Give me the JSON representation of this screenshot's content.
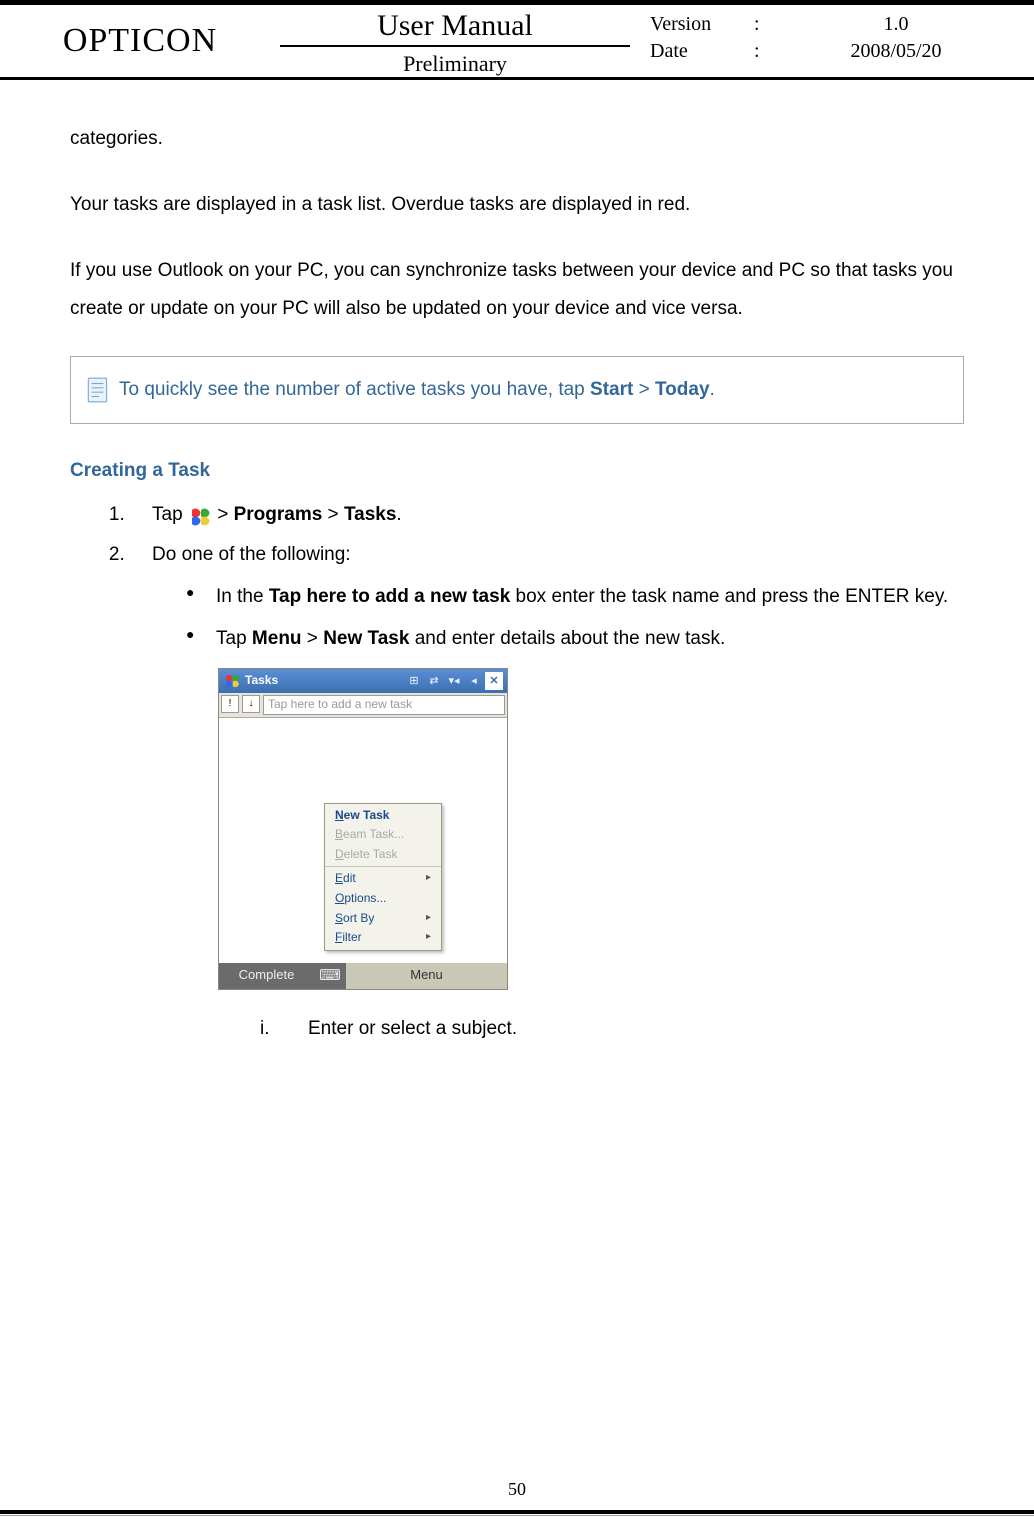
{
  "header": {
    "brand": "OPTICON",
    "title": "User Manual",
    "subtitle": "Preliminary",
    "version_label": "Version",
    "version_value": "1.0",
    "date_label": "Date",
    "date_value": "2008/05/20"
  },
  "body": {
    "p1": "categories.",
    "p2": "Your tasks are displayed in a task list. Overdue tasks are displayed in red.",
    "p3": "If you use Outlook on your PC, you can synchronize tasks between your device and PC so that tasks you create or update on your PC will also be updated on your device and vice versa.",
    "tip_prefix": " To quickly see the number of active tasks you have, tap ",
    "tip_b1": "Start",
    "tip_gt": " > ",
    "tip_b2": "Today",
    "tip_suffix": ".",
    "section": "Creating a Task",
    "step1_a": "Tap ",
    "step1_b1": "Programs",
    "step1_b2": "Tasks",
    "step2": "Do one of the following:",
    "bullet1_a": "In the ",
    "bullet1_b": "Tap here to add a new task",
    "bullet1_c": " box enter the task name and press the ENTER key.",
    "bullet2_a": "Tap ",
    "bullet2_b1": "Menu",
    "bullet2_b2": "New Task",
    "bullet2_c": " and enter details about the new task.",
    "subi_label": "i.",
    "subi_text": "Enter or select a subject."
  },
  "screenshot": {
    "title": "Tasks",
    "placeholder": "Tap here to add a new task",
    "menu": {
      "new_task": "New Task",
      "beam": "Beam Task...",
      "delete_task": "Delete Task",
      "edit": "Edit",
      "options": "Options...",
      "sort_by": "Sort By",
      "filter": "Filter"
    },
    "complete": "Complete",
    "menu_btn": "Menu"
  },
  "page_number": "50"
}
